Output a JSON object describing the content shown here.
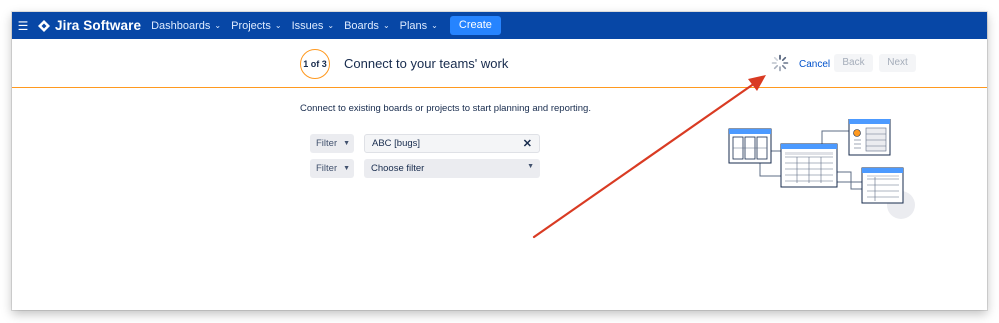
{
  "topbar": {
    "app_name": "Jira Software",
    "nav": [
      "Dashboards",
      "Projects",
      "Issues",
      "Boards",
      "Plans"
    ],
    "create_label": "Create"
  },
  "wizard": {
    "step": "1 of 3",
    "title": "Connect to your teams' work",
    "cancel": "Cancel",
    "back": "Back",
    "next": "Next"
  },
  "body": {
    "intro": "Connect to existing boards or projects to start planning and reporting.",
    "filters": [
      {
        "label": "Filter",
        "value": "ABC [bugs]"
      },
      {
        "label": "Filter",
        "value": "Choose filter"
      }
    ]
  },
  "colors": {
    "nav_bg": "#0747a6",
    "accent": "#ff991f",
    "create": "#2684ff",
    "arrow": "#d93b23",
    "link": "#0052cc"
  },
  "icons": [
    "menu-icon",
    "jira-logo-icon",
    "chevron-down-icon",
    "loading-spinner-icon",
    "clear-icon",
    "illustration"
  ]
}
